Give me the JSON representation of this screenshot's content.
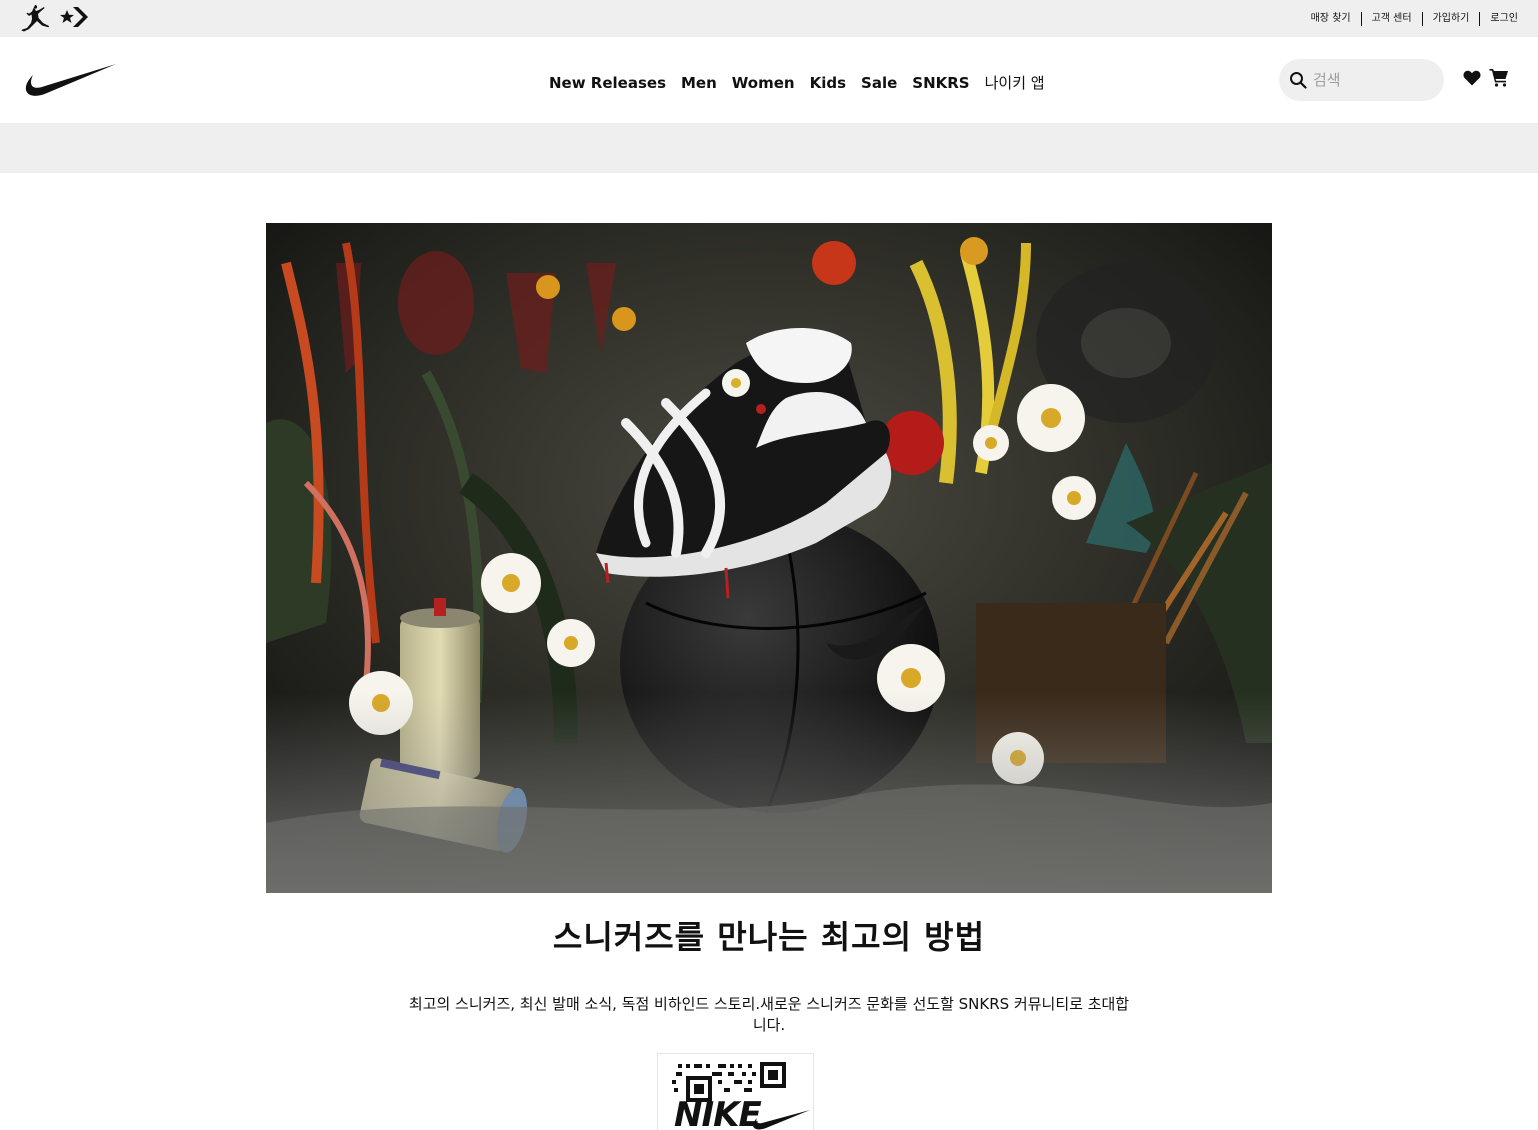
{
  "utility_bar": {
    "brands": [
      {
        "name": "jordan-logo"
      },
      {
        "name": "converse-logo"
      }
    ],
    "links": [
      "매장 찾기",
      "고객 센터",
      "가입하기",
      "로그인"
    ]
  },
  "header": {
    "logo": "nike-swoosh",
    "nav": [
      "New Releases",
      "Men",
      "Women",
      "Kids",
      "Sale",
      "SNKRS",
      "나이키 앱"
    ],
    "search": {
      "placeholder": "검색",
      "value": ""
    },
    "icons": [
      "search-icon",
      "heart-icon",
      "cart-icon"
    ]
  },
  "promo_banner": {
    "text": ""
  },
  "hero": {
    "image": "sneaker-on-basketball-with-flowers",
    "headline": "스니커즈를 만나는 최고의 방법",
    "description": "최고의 스니커즈, 최신 발매 소식, 독점 비하인드 스토리.새로운 스니커즈 문화를 선도할 SNKRS 커뮤니티로 초대합니다.",
    "qr_code": "nike-app-qr"
  },
  "colors": {
    "utility_bg": "#efefef",
    "text": "#111111",
    "placeholder": "#9e9e9e"
  }
}
